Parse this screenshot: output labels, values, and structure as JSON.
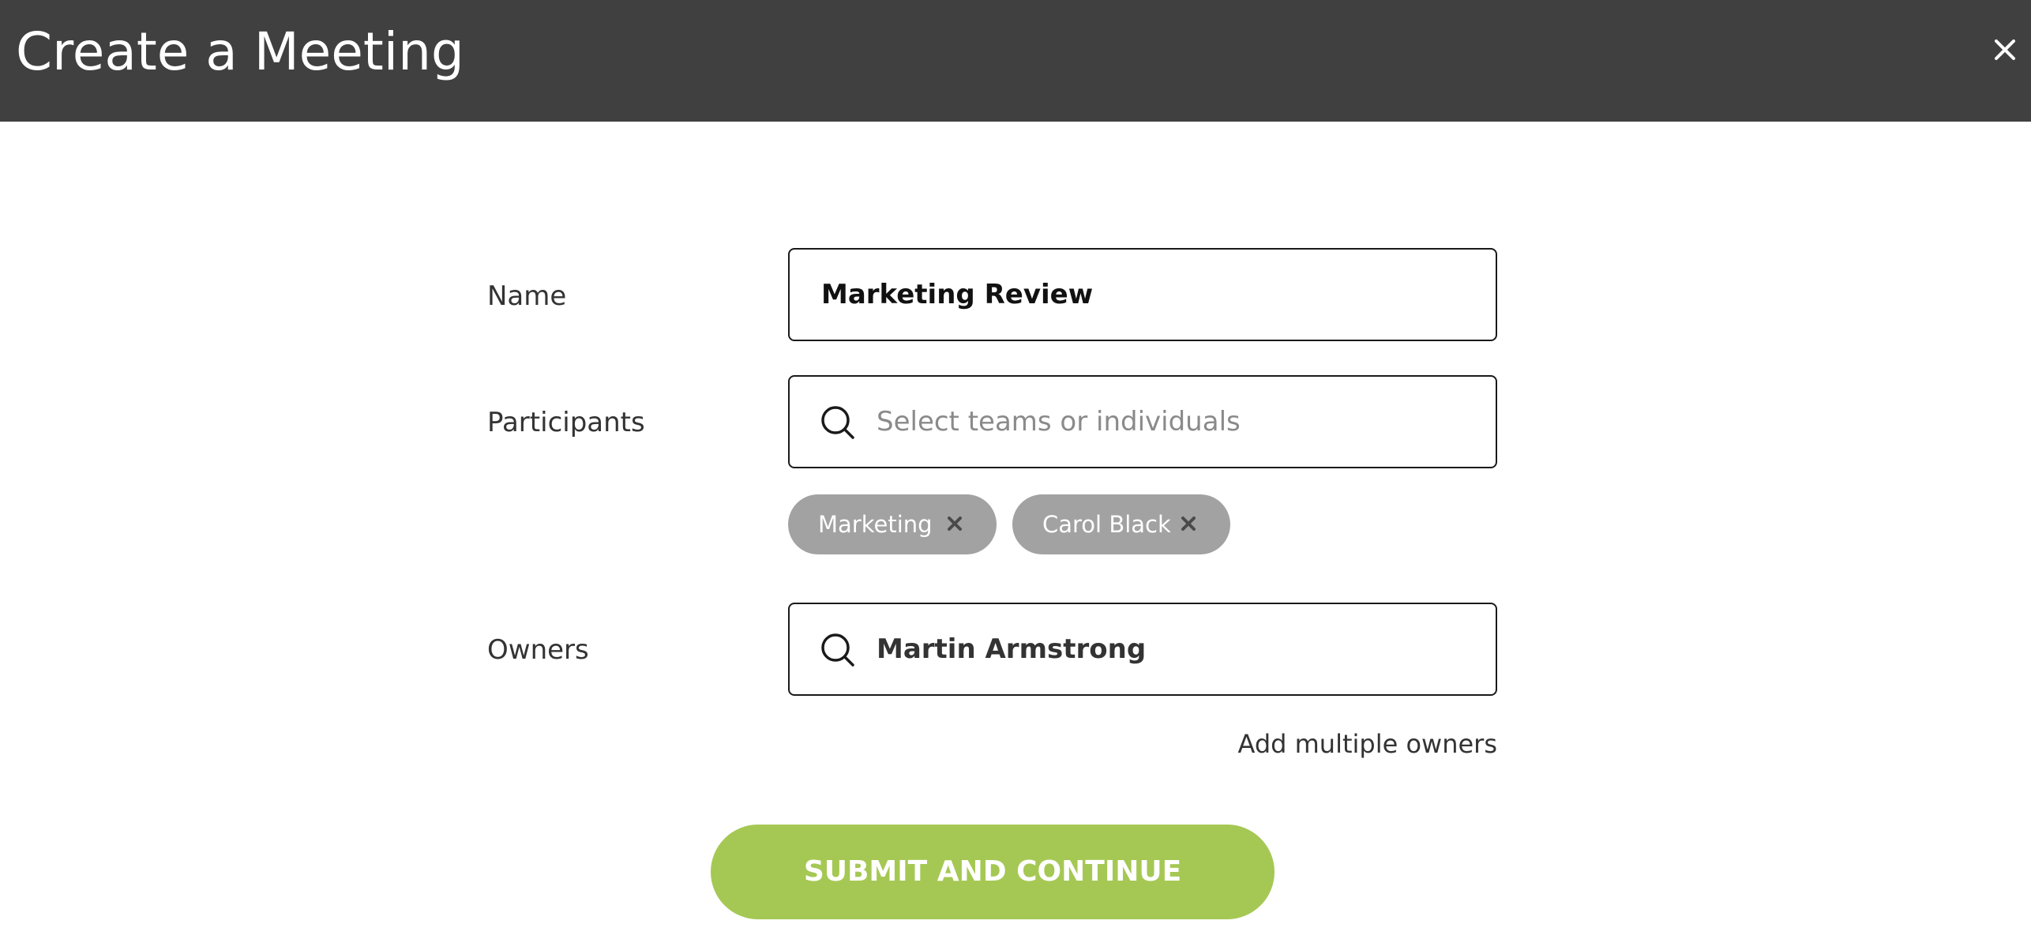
{
  "header": {
    "title": "Create a Meeting",
    "close_icon": "close-icon",
    "background_color": "#404040"
  },
  "form": {
    "name": {
      "label": "Name",
      "value": "Marketing Review"
    },
    "participants": {
      "label": "Participants",
      "placeholder": "Select teams or individuals",
      "value": "",
      "icon": "search-icon",
      "selected": [
        {
          "label": "Marketing",
          "remove_icon": "close-icon"
        },
        {
          "label": "Carol Black",
          "remove_icon": "close-icon"
        }
      ],
      "chip_color": "#a2a2a2"
    },
    "owners": {
      "label": "Owners",
      "value": "Martin Armstrong",
      "icon": "search-icon",
      "add_multiple_link": "Add multiple owners"
    }
  },
  "submit": {
    "label": "SUBMIT AND CONTINUE",
    "color": "#a5c854"
  }
}
